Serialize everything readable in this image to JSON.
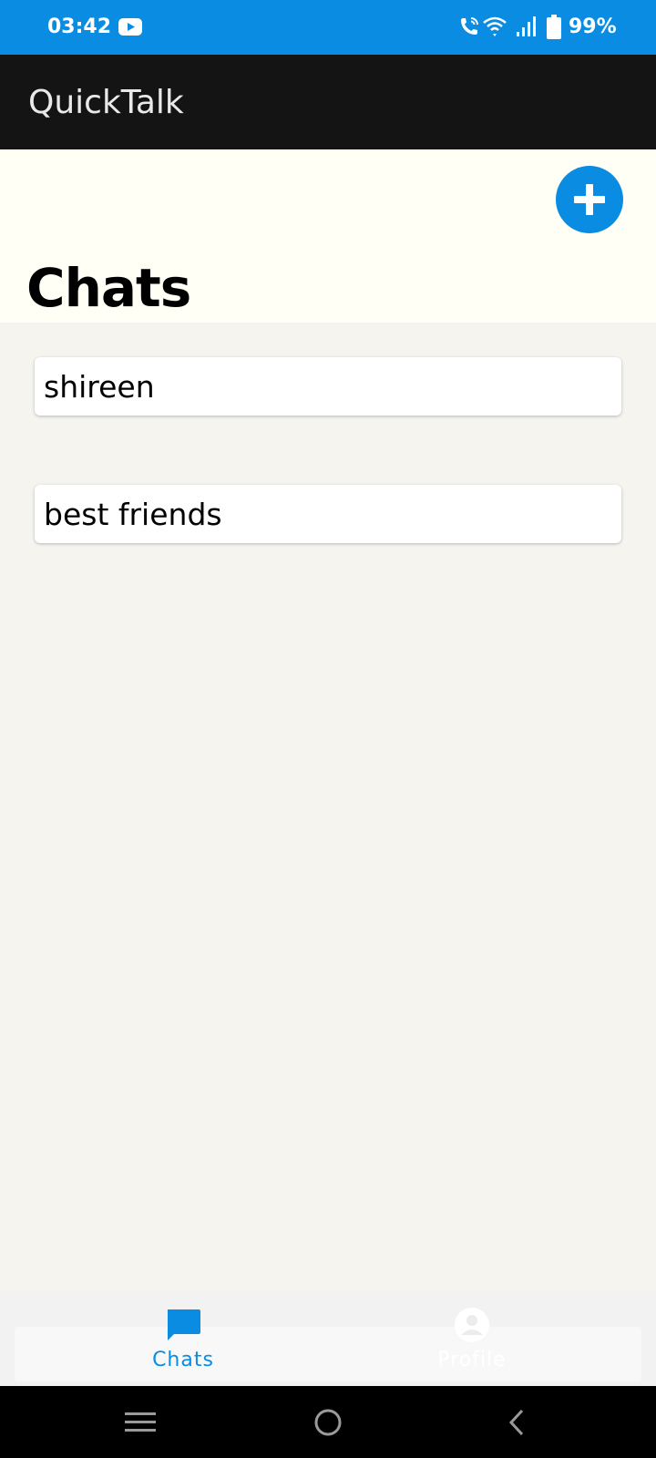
{
  "status_bar": {
    "time": "03:42",
    "battery": "99%",
    "icons": [
      "youtube-icon",
      "wifi-call-icon",
      "wifi-icon",
      "signal-icon",
      "battery-icon"
    ]
  },
  "app_bar": {
    "title": "QuickTalk"
  },
  "header": {
    "page_title": "Chats",
    "fab_icon": "plus-icon"
  },
  "chats": [
    {
      "name": "shireen"
    },
    {
      "name": "best friends"
    }
  ],
  "bottom_nav": {
    "tabs": [
      {
        "label": "Chats",
        "icon": "chat-bubble-icon",
        "active": true
      },
      {
        "label": "Profile",
        "icon": "account-circle-icon",
        "active": false
      }
    ]
  },
  "system_nav": {
    "buttons": [
      "recent-apps",
      "home",
      "back"
    ]
  },
  "colors": {
    "accent": "#0a8ce3",
    "app_bar": "#141414",
    "background": "#f5f4ef",
    "header_background": "#fffff6"
  }
}
